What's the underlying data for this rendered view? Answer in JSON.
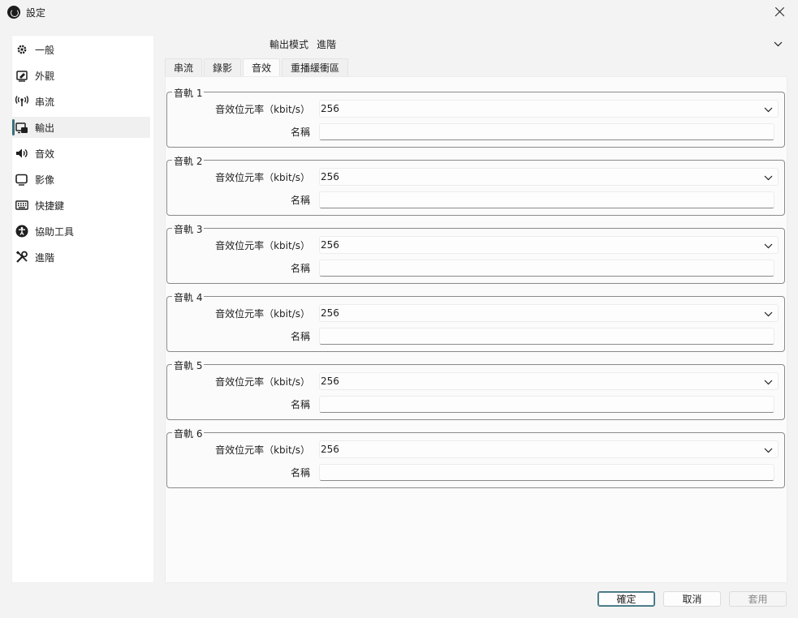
{
  "window": {
    "title": "設定"
  },
  "sidebar": {
    "items": [
      {
        "label": "一般",
        "icon": "gear-icon"
      },
      {
        "label": "外觀",
        "icon": "appearance-icon"
      },
      {
        "label": "串流",
        "icon": "antenna-icon"
      },
      {
        "label": "輸出",
        "icon": "output-icon",
        "active": true
      },
      {
        "label": "音效",
        "icon": "speaker-icon"
      },
      {
        "label": "影像",
        "icon": "monitor-icon"
      },
      {
        "label": "快捷鍵",
        "icon": "keyboard-icon"
      },
      {
        "label": "協助工具",
        "icon": "accessibility-icon"
      },
      {
        "label": "進階",
        "icon": "tools-icon"
      }
    ]
  },
  "output_mode": {
    "label": "輸出模式",
    "value": "進階"
  },
  "tabs": [
    {
      "label": "串流"
    },
    {
      "label": "錄影"
    },
    {
      "label": "音效",
      "active": true
    },
    {
      "label": "重播緩衝區"
    }
  ],
  "tracks": [
    {
      "title": "音軌 1",
      "bitrate_label": "音效位元率（kbit/s）",
      "bitrate": "256",
      "name_label": "名稱",
      "name": ""
    },
    {
      "title": "音軌 2",
      "bitrate_label": "音效位元率（kbit/s）",
      "bitrate": "256",
      "name_label": "名稱",
      "name": ""
    },
    {
      "title": "音軌 3",
      "bitrate_label": "音效位元率（kbit/s）",
      "bitrate": "256",
      "name_label": "名稱",
      "name": ""
    },
    {
      "title": "音軌 4",
      "bitrate_label": "音效位元率（kbit/s）",
      "bitrate": "256",
      "name_label": "名稱",
      "name": ""
    },
    {
      "title": "音軌 5",
      "bitrate_label": "音效位元率（kbit/s）",
      "bitrate": "256",
      "name_label": "名稱",
      "name": ""
    },
    {
      "title": "音軌 6",
      "bitrate_label": "音效位元率（kbit/s）",
      "bitrate": "256",
      "name_label": "名稱",
      "name": ""
    }
  ],
  "footer": {
    "ok": "確定",
    "cancel": "取消",
    "apply": "套用"
  },
  "colors": {
    "accent": "#3b6e7a"
  }
}
